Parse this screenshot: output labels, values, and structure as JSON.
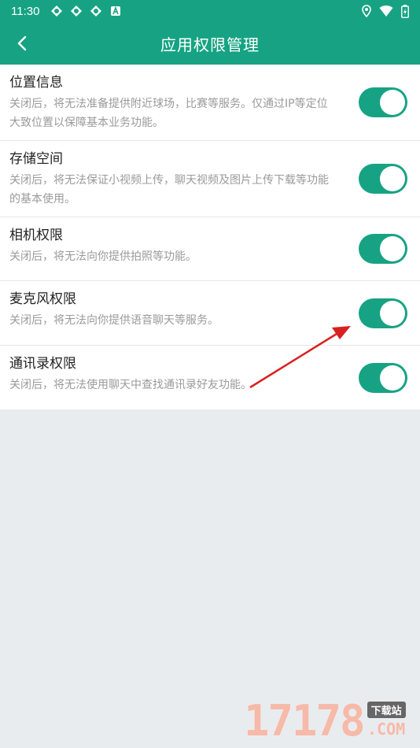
{
  "status_bar": {
    "time": "11:30",
    "left_icons": [
      "app-notification-icon",
      "app-notification-icon",
      "app-notification-icon",
      "a-badge-icon"
    ],
    "right_icons": [
      "location-icon",
      "wifi-icon",
      "battery-charging-icon"
    ]
  },
  "header": {
    "title": "应用权限管理",
    "back_icon": "chevron-left-icon"
  },
  "permissions": [
    {
      "name": "位置信息",
      "desc": "关闭后，将无法准备提供附近球场，比赛等服务。仅通过IP等定位大致位置以保障基本业务功能。",
      "enabled": true
    },
    {
      "name": "存储空间",
      "desc": "关闭后，将无法保证小视频上传，聊天视频及图片上传下载等功能的基本使用。",
      "enabled": true
    },
    {
      "name": "相机权限",
      "desc": "关闭后，将无法向你提供拍照等功能。",
      "enabled": true
    },
    {
      "name": "麦克风权限",
      "desc": "关闭后，将无法向你提供语音聊天等服务。",
      "enabled": true
    },
    {
      "name": "通讯录权限",
      "desc": "关闭后，将无法使用聊天中查找通讯录好友功能。",
      "enabled": true
    }
  ],
  "colors": {
    "primary": "#17a383",
    "background": "#e9ecef",
    "annotation_arrow": "#d92020"
  },
  "watermark": {
    "number": "17178",
    "tag": "下载站",
    "domain": ".COM"
  }
}
